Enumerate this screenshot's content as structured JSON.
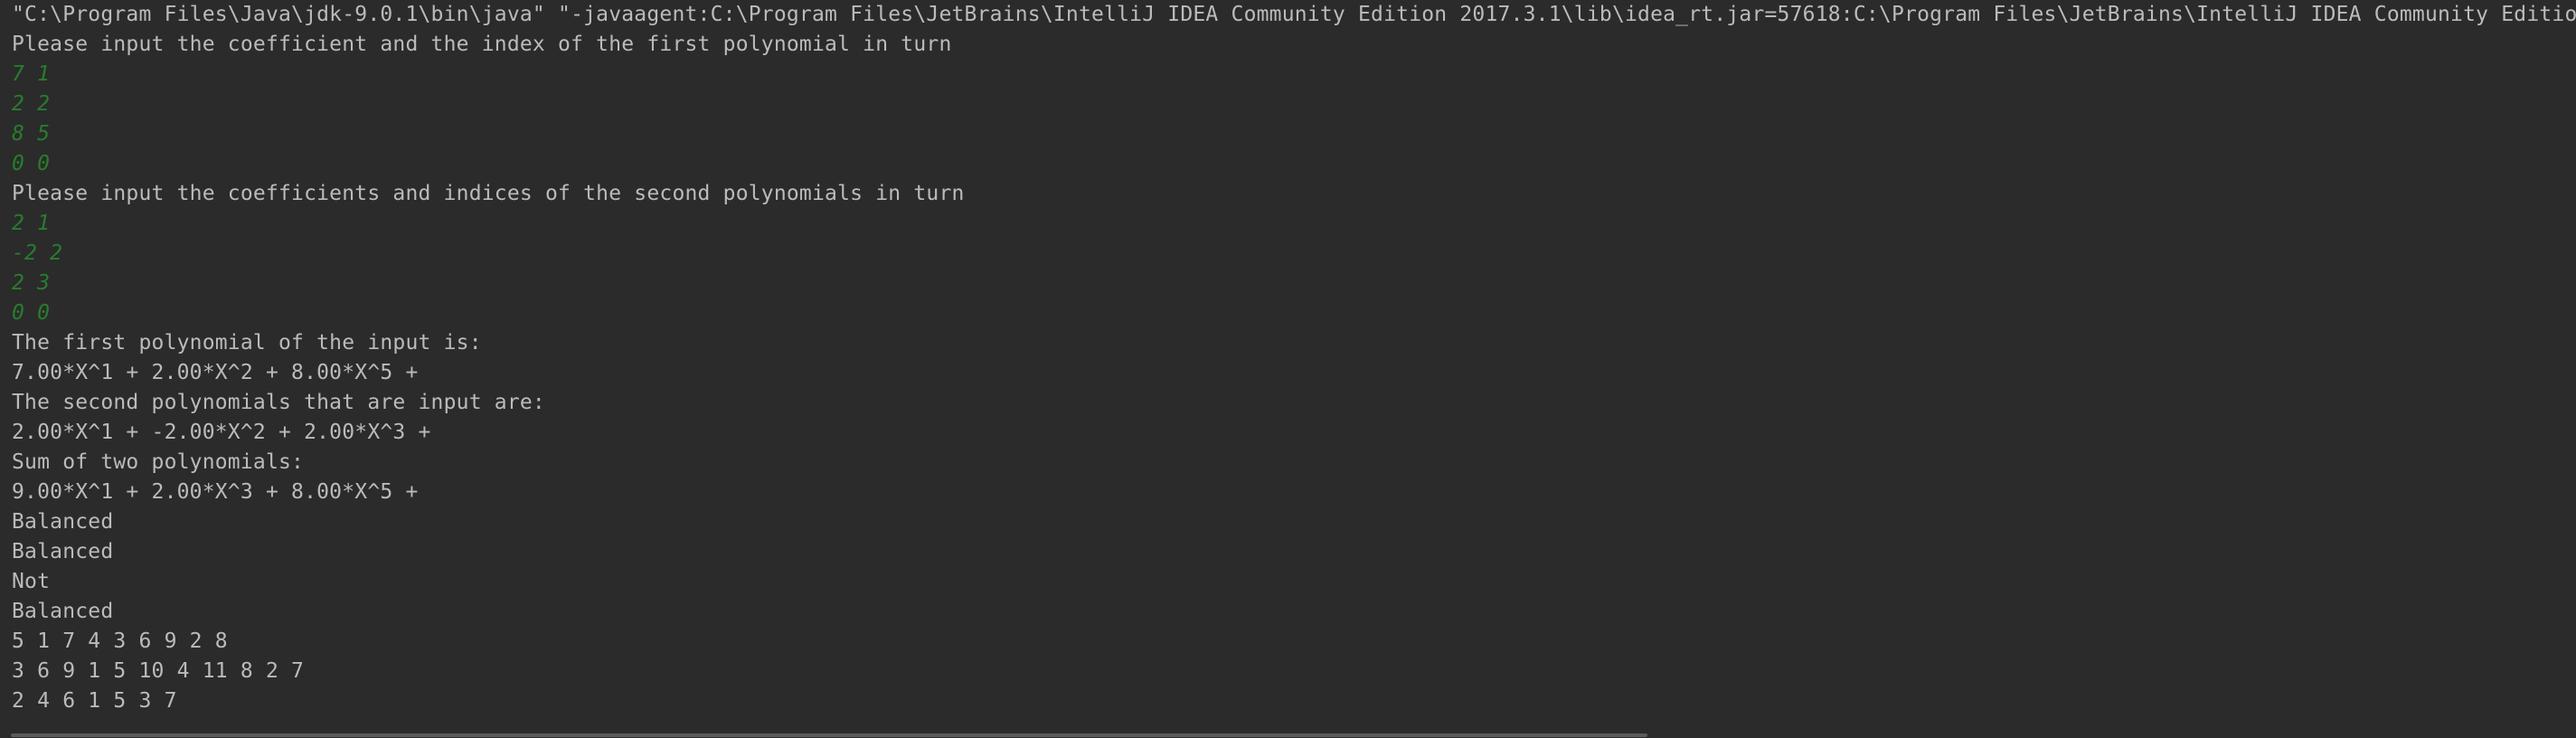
{
  "console": {
    "lines": [
      {
        "text": "\"C:\\Program Files\\Java\\jdk-9.0.1\\bin\\java\" \"-javaagent:C:\\Program Files\\JetBrains\\IntelliJ IDEA Community Edition 2017.3.1\\lib\\idea_rt.jar=57618:C:\\Program Files\\JetBrains\\IntelliJ IDEA Community Edition",
        "kind": "cmd"
      },
      {
        "text": "Please input the coefficient and the index of the first polynomial in turn",
        "kind": "output"
      },
      {
        "text": "7 1",
        "kind": "input"
      },
      {
        "text": "2 2",
        "kind": "input"
      },
      {
        "text": "8 5",
        "kind": "input"
      },
      {
        "text": "0 0",
        "kind": "input"
      },
      {
        "text": "Please input the coefficients and indices of the second polynomials in turn",
        "kind": "output"
      },
      {
        "text": "2 1",
        "kind": "input"
      },
      {
        "text": "-2 2",
        "kind": "input"
      },
      {
        "text": "2 3",
        "kind": "input"
      },
      {
        "text": "0 0",
        "kind": "input"
      },
      {
        "text": "The first polynomial of the input is:",
        "kind": "output"
      },
      {
        "text": "7.00*X^1 + 2.00*X^2 + 8.00*X^5 +",
        "kind": "output"
      },
      {
        "text": "The second polynomials that are input are:",
        "kind": "output"
      },
      {
        "text": "2.00*X^1 + -2.00*X^2 + 2.00*X^3 +",
        "kind": "output"
      },
      {
        "text": "Sum of two polynomials:",
        "kind": "output"
      },
      {
        "text": "9.00*X^1 + 2.00*X^3 + 8.00*X^5 +",
        "kind": "output"
      },
      {
        "text": "Balanced",
        "kind": "output"
      },
      {
        "text": "Balanced",
        "kind": "output"
      },
      {
        "text": "Not",
        "kind": "output"
      },
      {
        "text": "Balanced",
        "kind": "output"
      },
      {
        "text": "5 1 7 4 3 6 9 2 8",
        "kind": "output"
      },
      {
        "text": "3 6 9 1 5 10 4 11 8 2 7",
        "kind": "output"
      },
      {
        "text": "2 4 6 1 5 3 7",
        "kind": "output"
      }
    ]
  },
  "colors": {
    "background": "#2b2b2b",
    "output_text": "#bbbbbb",
    "user_input_text": "#287d2c",
    "scrollbar": "#5a5a5a"
  }
}
